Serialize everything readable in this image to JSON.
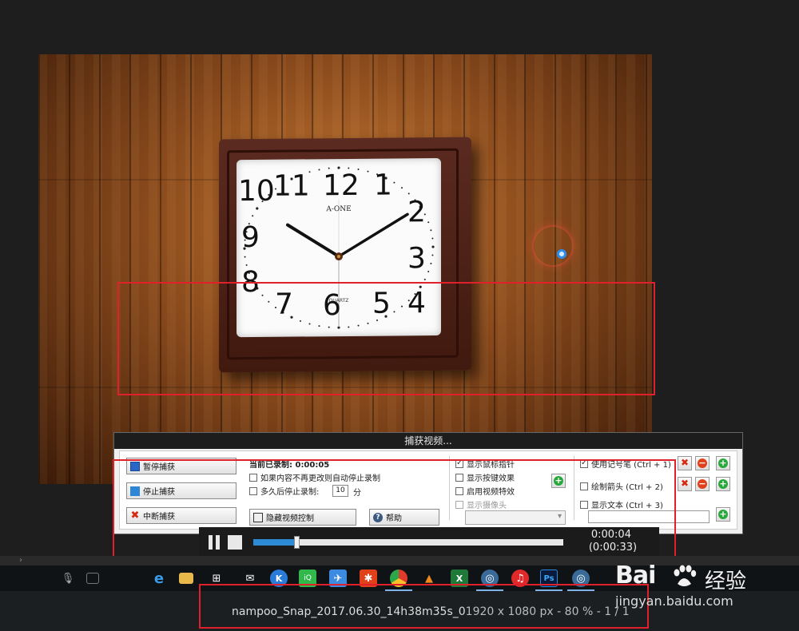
{
  "photo": {
    "clock_brand": "A-ONE",
    "clock_subtext": "QUARTZ",
    "clock_numbers": [
      "12",
      "1",
      "2",
      "3",
      "4",
      "5",
      "6",
      "7",
      "8",
      "9",
      "10",
      "11"
    ]
  },
  "capture_dialog": {
    "title": "捕获视频...",
    "pause_capture_label": "暂停捕获",
    "stop_capture_label": "停止捕获",
    "abort_capture_label": "中断捕获",
    "recorded_label": "当前已录制: 0:00:05",
    "auto_stop_label": "如果内容不再更改则自动停止录制",
    "stop_after_label": "多久后停止录制:",
    "stop_after_value": "10",
    "stop_after_unit": "分",
    "hide_video_control_label": "隐藏视频控制",
    "help_label": "帮助",
    "show_mouse_pointer_label": "显示鼠标指针",
    "show_key_effect_label": "显示按键效果",
    "enable_video_effect_label": "启用视频特效",
    "show_camera_label": "显示摄像头",
    "use_pen_label": "使用记号笔 (Ctrl + 1)",
    "draw_arrow_label": "绘制箭头 (Ctrl + 2)",
    "show_text_label": "显示文本 (Ctrl + 3)"
  },
  "playback": {
    "elapsed": "0:00:04",
    "total": "(0:00:33)",
    "progress_fraction": 0.14
  },
  "strip": {
    "arrow": "›"
  },
  "statusbar": {
    "filename": "nampoo_Snap_2017.06.30_14h38m35s_0",
    "details": "1920 x 1080 px - 80 % - 1 / 1"
  },
  "watermark": {
    "logo": "Bai",
    "jingyan": "经验",
    "url": "jingyan.baidu.com"
  },
  "colors": {
    "accent_blue": "#2d8bd6",
    "highlight_red": "#e0202a"
  }
}
